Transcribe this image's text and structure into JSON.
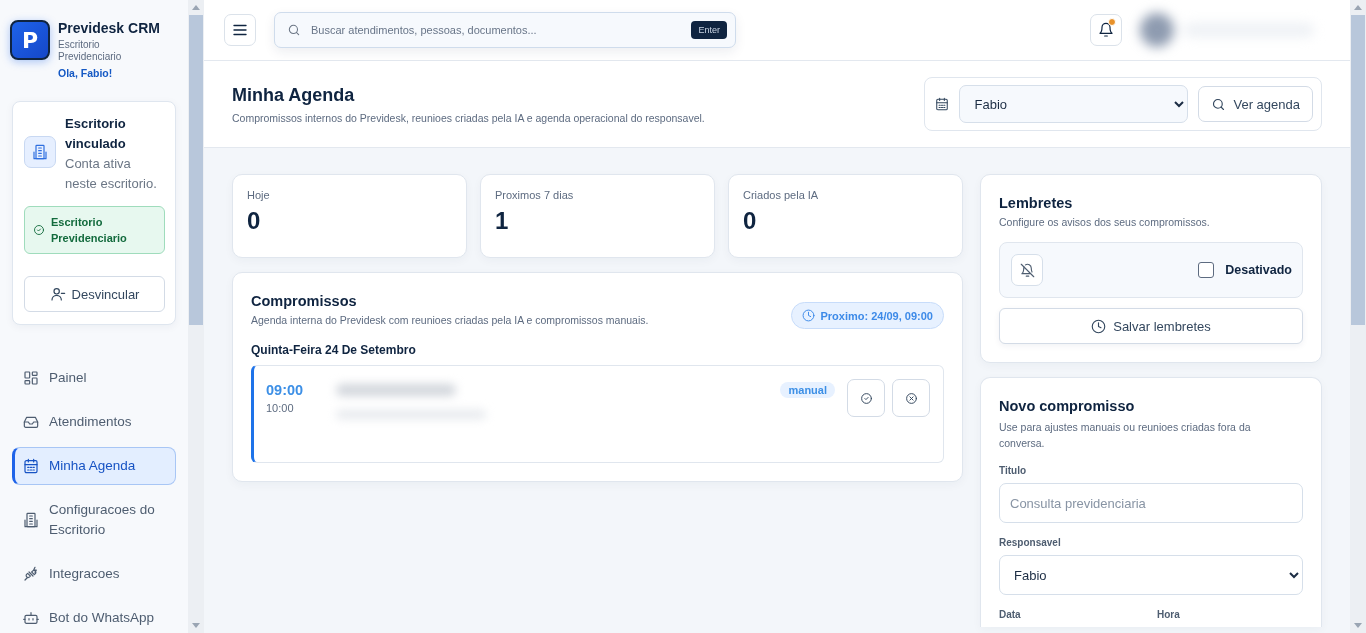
{
  "sidebar": {
    "brand": "Previdesk CRM",
    "brand_letter": "P",
    "subtitle": "Escritorio Previdenciario",
    "greeting": "Ola, Fabio!",
    "office_card": {
      "title": "Escritorio vinculado",
      "description": "Conta ativa neste escritorio.",
      "office_name": "Escritorio Previdenciario",
      "unlink_button": "Desvincular"
    },
    "items": [
      {
        "label": "Painel",
        "kind": "grid",
        "selected": false
      },
      {
        "label": "Atendimentos",
        "kind": "inbox",
        "selected": false
      },
      {
        "label": "Minha Agenda",
        "kind": "calendar",
        "selected": true
      },
      {
        "label": "Configuracoes do Escritorio",
        "kind": "building",
        "selected": false
      },
      {
        "label": "Integracoes",
        "kind": "plug",
        "selected": false
      },
      {
        "label": "Bot do WhatsApp",
        "kind": "bot",
        "selected": false
      }
    ]
  },
  "topbar": {
    "search": {
      "placeholder": "Buscar atendimentos, pessoas, documentos...",
      "key_hint": "Enter"
    },
    "notifications": {
      "unread": true
    }
  },
  "header": {
    "title": "Minha Agenda",
    "subtitle": "Compromissos internos do Previdesk, reunioes criadas pela IA e agenda operacional do responsavel.",
    "responsible_select": "Fabio",
    "view_button": "Ver agenda"
  },
  "stats": [
    {
      "label": "Hoje",
      "value": "0"
    },
    {
      "label": "Proximos 7 dias",
      "value": "1"
    },
    {
      "label": "Criados pela IA",
      "value": "0"
    }
  ],
  "appointments": {
    "title": "Compromissos",
    "subtitle": "Agenda interna do Previdesk com reunioes criadas pela IA e compromissos manuais.",
    "next_badge": "Proximo: 24/09, 09:00",
    "day_label": "Quinta-Feira 24 De Setembro",
    "events": [
      {
        "start": "09:00",
        "end": "10:00",
        "tag": "manual"
      }
    ]
  },
  "reminders": {
    "title": "Lembretes",
    "subtitle": "Configure os avisos dos seus compromissos.",
    "checked": false,
    "status_label": "Desativado",
    "save_button": "Salvar lembretes"
  },
  "new_appointment": {
    "title": "Novo compromisso",
    "subtitle": "Use para ajustes manuais ou reunioes criadas fora da conversa.",
    "fields": [
      {
        "label": "Titulo",
        "kind": "text",
        "placeholder": "Consulta previdenciaria"
      },
      {
        "label": "Responsavel",
        "kind": "select",
        "value": "Fabio"
      }
    ],
    "date_row": [
      {
        "label": "Data"
      },
      {
        "label": "Hora"
      }
    ]
  }
}
